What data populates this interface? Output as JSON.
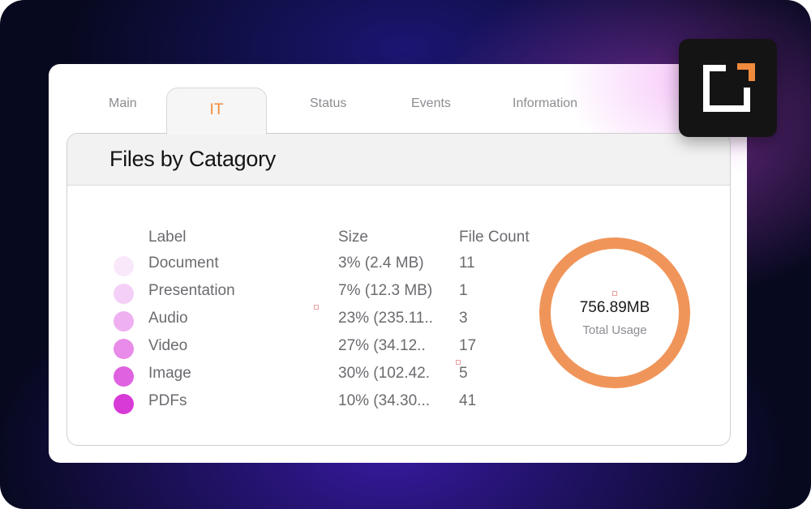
{
  "tabs": {
    "main": "Main",
    "it": "IT",
    "status": "Status",
    "events": "Events",
    "information": "Information",
    "active": "IT"
  },
  "card": {
    "title": "Files by Catagory",
    "columns": {
      "label": "Label",
      "size": "Size",
      "count": "File Count"
    },
    "rows": [
      {
        "label": "Document",
        "size": "3% (2.4 MB)",
        "count": "11",
        "color": "#f9e8fa"
      },
      {
        "label": "Presentation",
        "size": "7% (12.3 MB)",
        "count": "1",
        "color": "#f4cff6"
      },
      {
        "label": "Audio",
        "size": "23% (235.11..",
        "count": "3",
        "color": "#eeb0f0"
      },
      {
        "label": "Video",
        "size": "27% (34.12..",
        "count": "17",
        "color": "#e88be9"
      },
      {
        "label": "Image",
        "size": "30% (102.42.",
        "count": "5",
        "color": "#df62e0"
      },
      {
        "label": "PDFs",
        "size": "10% (34.30...",
        "count": "41",
        "color": "#d83ad8"
      }
    ],
    "total": {
      "value": "756.89MB",
      "label": "Total Usage",
      "ring_color": "#f0955a"
    }
  },
  "colors": {
    "accent": "#f08a3c",
    "logo_bg": "#141414",
    "logo_corner": "#f08a3c"
  },
  "logo": {
    "icon": "corner-brackets-logo"
  }
}
